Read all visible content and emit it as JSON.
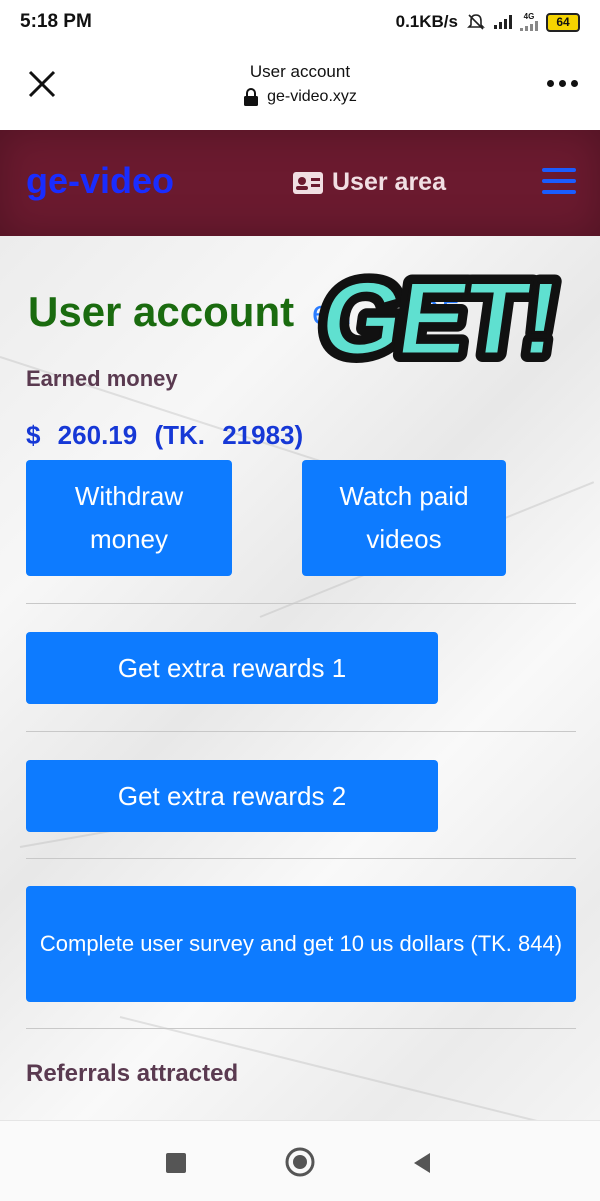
{
  "status_bar": {
    "time": "5:18 PM",
    "network_speed": "0.1KB/s",
    "network_type": "4G",
    "battery": "64",
    "icons": [
      "mute-icon",
      "signal-icon",
      "signal-4g-icon",
      "battery-icon"
    ]
  },
  "browser": {
    "title": "User account",
    "url": "ge-video.xyz",
    "icons": [
      "close-icon",
      "lock-icon",
      "more-icon"
    ]
  },
  "site_header": {
    "brand": "ge-video",
    "user_area": "User area",
    "icons": [
      "id-card-icon",
      "menu-icon"
    ]
  },
  "main": {
    "title": "User account",
    "title_tail": "ed... 005",
    "sticker_text": "GET!",
    "earned_label": "Earned money",
    "amount": "$ 260.19",
    "amount_local": "(TK. 21983)",
    "buttons": {
      "withdraw_line1": "Withdraw",
      "withdraw_line2": "money",
      "watch_line1": "Watch paid",
      "watch_line2": "videos",
      "rewards1": "Get extra rewards 1",
      "rewards2": "Get extra rewards 2",
      "survey": "Complete user survey and get 10 us dollars (TK. 844)"
    },
    "referrals_label": "Referrals attracted"
  },
  "colors": {
    "header_bg": "#6b1a2f",
    "brand": "#1a2cff",
    "button": "#0d7bff",
    "title_green": "#1a6b0f",
    "amount_blue": "#1638d6"
  },
  "nav_icons": [
    "recents-icon",
    "home-icon",
    "back-icon"
  ]
}
